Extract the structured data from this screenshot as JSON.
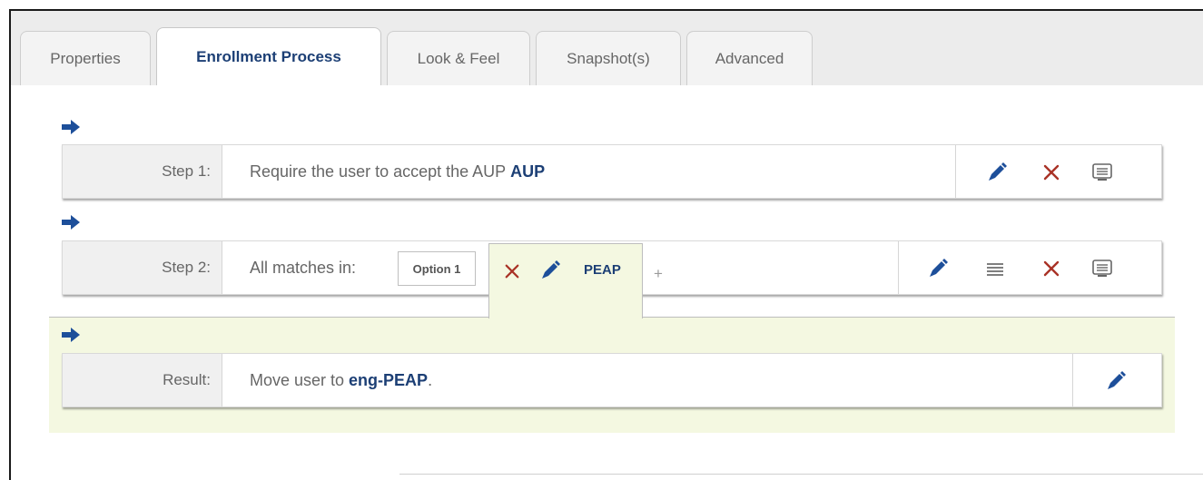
{
  "tabs": [
    {
      "label": "Properties",
      "active": false
    },
    {
      "label": "Enrollment Process",
      "active": true
    },
    {
      "label": "Look & Feel",
      "active": false
    },
    {
      "label": "Snapshot(s)",
      "active": false
    },
    {
      "label": "Advanced",
      "active": false
    }
  ],
  "steps": [
    {
      "label": "Step 1:",
      "text": "Require the user to accept the AUP",
      "bold": "AUP",
      "actions": [
        "edit-icon",
        "delete-icon",
        "comment-icon"
      ]
    },
    {
      "label": "Step 2:",
      "text": "All matches in:",
      "option": "Option 1",
      "selected_option": "PEAP",
      "add_option": "+",
      "actions": [
        "edit-icon",
        "reorder-icon",
        "delete-icon",
        "comment-icon"
      ]
    }
  ],
  "result": {
    "label": "Result:",
    "text_before": "Move user to",
    "bold": "eng-PEAP",
    "text_after": ".",
    "actions": [
      "edit-icon"
    ]
  },
  "colors": {
    "accent": "#1c3f75",
    "icon_blue": "#1d4f9a",
    "delete_red": "#a93226",
    "result_band": "#f4f8e1"
  }
}
